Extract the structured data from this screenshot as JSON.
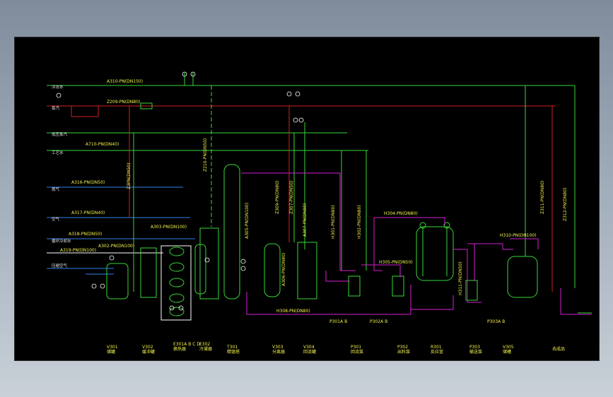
{
  "colors": {
    "canvas": "#000000",
    "green": "#39d739",
    "red": "#d32020",
    "magenta": "#d21fd2",
    "blue": "#2f7fe6",
    "white": "#ffffff",
    "yellow": "#f2f24a"
  },
  "utilities": {
    "cold_water": "冷冻水",
    "steam": "蒸汽",
    "low_pressure": "低压蒸汽",
    "process_water": "工艺水",
    "nitrogen": "氮气",
    "air": "空气",
    "circulating_water": "循环冷却水",
    "compressed_air": "压缩空气"
  },
  "pipe_labels": [
    "A310-PN(DN150)",
    "Z209-PN(DN80)",
    "A710-PN(DN40)",
    "A316-PN(DN50)",
    "A317-PN(DN40)",
    "A318-PN(DN50)",
    "A319-PN(DN100)",
    "A302-PN(DN100)",
    "A303-PN(DN100)",
    "Z210-PN(DN50)",
    "A305-PN(DN100)",
    "A306-PN(DN80)",
    "A307-PN(DN80)",
    "Z309-PN(DN80)",
    "Z307-PN(DN50)",
    "H301-PN(DN80)",
    "H302-PN(DN80)",
    "H304-PN(DN80)",
    "H305-PN(DN50)",
    "H308-PN(DN80)",
    "H310-PN(DN100)",
    "H311-PN(DN50)",
    "Z3PN(DN50)",
    "Z311-PN(DN80)",
    "Z312-PN(DN80)"
  ],
  "pumps": [
    "P301A B",
    "P302A B",
    "P303A B"
  ],
  "equipment": [
    {
      "tag": "V301",
      "name": "储罐"
    },
    {
      "tag": "V302",
      "name": "缓冲罐"
    },
    {
      "tag": "E301A B C D",
      "name": "换热器"
    },
    {
      "tag": "E302",
      "name": "冷凝器"
    },
    {
      "tag": "T301",
      "name": "精馏塔"
    },
    {
      "tag": "V303",
      "name": "分离器"
    },
    {
      "tag": "V304",
      "name": "回流罐"
    },
    {
      "tag": "P301",
      "name": "回流泵"
    },
    {
      "tag": "P302",
      "name": "出料泵"
    },
    {
      "tag": "R301",
      "name": "反应釜"
    },
    {
      "tag": "P303",
      "name": "输送泵"
    },
    {
      "tag": "V305",
      "name": "储槽"
    },
    {
      "tag": "",
      "name": "去成品"
    }
  ]
}
